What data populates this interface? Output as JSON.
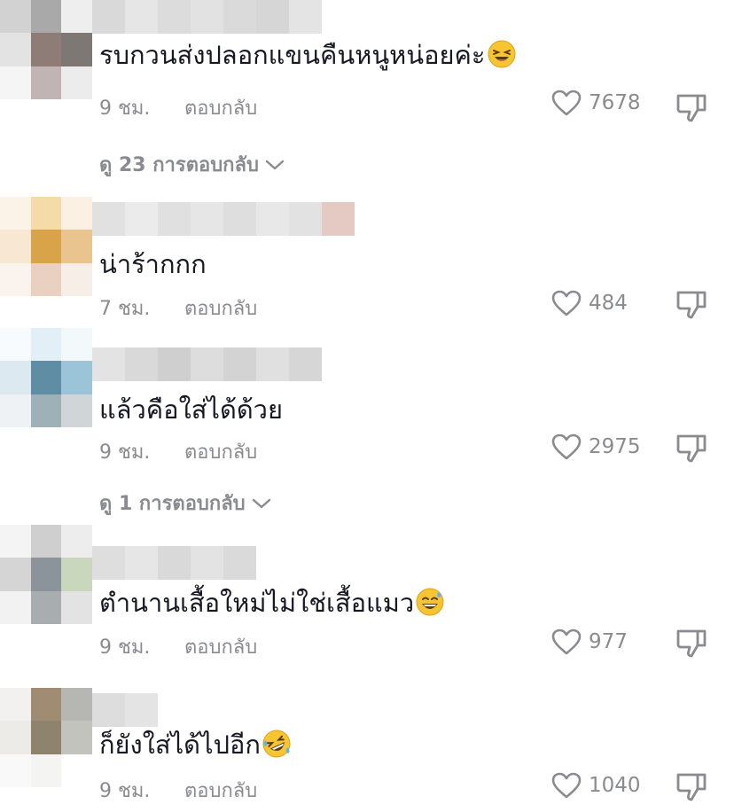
{
  "comments": [
    {
      "text": "รบกวนส่งปลอกแขนคืนหนูหน่อยค่ะ",
      "emoji": "laughing-emoji",
      "time": "9 ชม.",
      "reply_label": "ตอบกลับ",
      "likes": "7678",
      "view_replies": "ดู 23 การตอบกลับ",
      "avatar_colors": [
        "#d2d2d2",
        "#a9a9a9",
        "#eeeeee",
        "#e3e3e3",
        "#8e7d76",
        "#7d7873",
        "#f5f5f5",
        "#c0b4b4",
        "#ececec"
      ],
      "name_colors": [
        "#d9d9d9",
        "#e6e6e6",
        "#dcdcdc",
        "#e2e2e2",
        "#dadada",
        "#d6d6d6",
        "#e4e4e4"
      ]
    },
    {
      "text": "น่าร้ากกก",
      "emoji": "",
      "time": "7 ชม.",
      "reply_label": "ตอบกลับ",
      "likes": "484",
      "view_replies": "",
      "avatar_colors": [
        "#fbf3e8",
        "#f4dba8",
        "#fbf0e2",
        "#f8e7d2",
        "#d9a349",
        "#e9c48e",
        "#fbf4ee",
        "#ead0c0",
        "#f7eee8"
      ],
      "name_colors": [
        "#e1e1e1",
        "#ebebeb",
        "#e0e0e0",
        "#e6e6e6",
        "#dedede",
        "#e8e8e8",
        "#e2e2e2",
        "#e5c9c3"
      ]
    },
    {
      "text": "แล้วคือใส่ได้ด้วย",
      "emoji": "",
      "time": "9 ชม.",
      "reply_label": "ตอบกลับ",
      "likes": "2975",
      "view_replies": "ดู 1 การตอบกลับ",
      "avatar_colors": [
        "#f7fbfd",
        "#e3eff6",
        "#f3f8fb",
        "#dce9f1",
        "#5f8ea4",
        "#9cc4d8",
        "#eef2f4",
        "#9eb0b8",
        "#d0d6d8"
      ],
      "name_colors": [
        "#e3e3e3",
        "#d9d9d9",
        "#cfcfcf",
        "#dddddd",
        "#d3d3d3",
        "#e0e0e0",
        "#d6d6d6"
      ]
    },
    {
      "text": "ตำนานเสื้อใหม่ไม่ใช่เสื้อแมว",
      "emoji": "sweat-smile-emoji",
      "time": "9 ชม.",
      "reply_label": "ตอบกลับ",
      "likes": "977",
      "view_replies": "",
      "avatar_colors": [
        "#f4f4f4",
        "#cfcfcf",
        "#ededed",
        "#d5d5d5",
        "#8a949a",
        "#c9d7bd",
        "#f2f2f2",
        "#a8aeb0",
        "#e3e3e3"
      ],
      "name_colors": [
        "#dedede",
        "#e6e6e6",
        "#d9d9d9",
        "#e3e3e3",
        "#dadada"
      ]
    },
    {
      "text": "ก็ยังใส่ได้ไปอีก",
      "emoji": "rofl-emoji",
      "time": "9 ชม.",
      "reply_label": "ตอบกลับ",
      "likes": "1040",
      "view_replies": "",
      "avatar_colors": [
        "#f2f1f0",
        "#a08c73",
        "#b6b6b2",
        "#ecebe8",
        "#8e836c",
        "#c3c3be",
        "#f9f9f9",
        "#f4f4f2",
        "#ffffff"
      ],
      "name_colors": [
        "#dddddd",
        "#e4e4e4"
      ]
    }
  ],
  "colors": {
    "text": "#161823",
    "muted": "#8a8b91",
    "background": "#ffffff"
  },
  "icons": {
    "like": "heart-outline-icon",
    "dislike": "thumbs-down-outline-icon",
    "expand": "chevron-down-icon"
  }
}
